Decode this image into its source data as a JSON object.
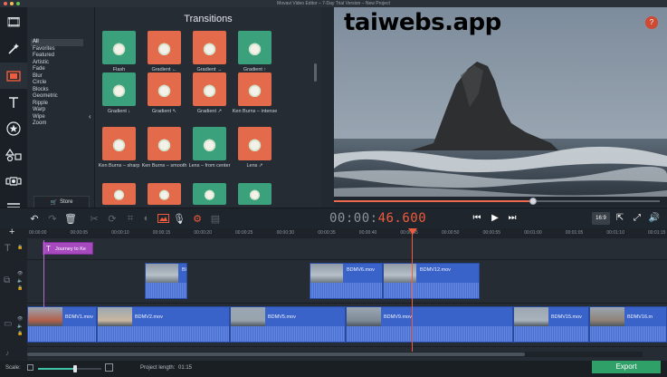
{
  "window": {
    "title": "Movavi Video Editor – 7-Day Trial Version – New Project"
  },
  "watermark": "taiwebs.app",
  "tools": [
    {
      "name": "import",
      "icon": "film-icon"
    },
    {
      "name": "filters",
      "icon": "magic-wand-icon"
    },
    {
      "name": "transitions",
      "icon": "transitions-icon"
    },
    {
      "name": "titles",
      "icon": "text-icon"
    },
    {
      "name": "stickers",
      "icon": "star-icon"
    },
    {
      "name": "shapes",
      "icon": "shapes-icon"
    },
    {
      "name": "zoom-pan",
      "icon": "camera-icon"
    },
    {
      "name": "more",
      "icon": "menu-icon"
    }
  ],
  "categories": [
    "All",
    "Favorites",
    "Featured",
    "Artistic",
    "Fade",
    "Blur",
    "Circle",
    "Blocks",
    "Geometric",
    "Ripple",
    "Warp",
    "Wipe",
    "Zoom"
  ],
  "selected_category": "All",
  "store_label": "Store",
  "transitions_title": "Transitions",
  "transitions": [
    {
      "label": "Flash",
      "row": 0,
      "col": 0,
      "bg": "#3aa17c"
    },
    {
      "label": "Gradient ←",
      "row": 0,
      "col": 1,
      "bg": "#e36a4a"
    },
    {
      "label": "Gradient →",
      "row": 0,
      "col": 2,
      "bg": "#e36a4a"
    },
    {
      "label": "Gradient ↑",
      "row": 0,
      "col": 3,
      "bg": "#3aa17c"
    },
    {
      "label": "Gradient ↓",
      "row": 1,
      "col": 0,
      "bg": "#3aa17c"
    },
    {
      "label": "Gradient ↖",
      "row": 1,
      "col": 1,
      "bg": "#e36a4a"
    },
    {
      "label": "Gradient ↗",
      "row": 1,
      "col": 2,
      "bg": "#e36a4a"
    },
    {
      "label": "Ken Burns – intense",
      "row": 1,
      "col": 3,
      "bg": "#e36a4a"
    },
    {
      "label": "Ken Burns – sharp",
      "row": 2,
      "col": 0,
      "bg": "#e36a4a"
    },
    {
      "label": "Ken Burns – smooth",
      "row": 2,
      "col": 1,
      "bg": "#e36a4a"
    },
    {
      "label": "Lens – from center",
      "row": 2,
      "col": 2,
      "bg": "#3aa17c"
    },
    {
      "label": "Lens ↗",
      "row": 2,
      "col": 3,
      "bg": "#e36a4a"
    },
    {
      "label": "",
      "row": 3,
      "col": 0,
      "bg": "#e36a4a"
    },
    {
      "label": "",
      "row": 3,
      "col": 1,
      "bg": "#e36a4a"
    },
    {
      "label": "",
      "row": 3,
      "col": 2,
      "bg": "#3aa17c"
    },
    {
      "label": "",
      "row": 3,
      "col": 3,
      "bg": "#3aa17c"
    }
  ],
  "help_label": "?",
  "player": {
    "timecode_base": "00:00:",
    "timecode_accent": "46.600",
    "progress": 0.61,
    "aspect_label": "16:9"
  },
  "ruler_ticks": [
    "00:00:00",
    "00:00:05",
    "00:00:10",
    "00:00:15",
    "00:00:20",
    "00:00:25",
    "00:00:30",
    "00:00:35",
    "00:00:40",
    "00:00:45",
    "00:00:50",
    "00:00:55",
    "00:01:00",
    "00:01:05",
    "00:01:10",
    "00:01:15"
  ],
  "title_clip": "Journey to Ke",
  "overlay_clips": [
    {
      "name": "BDMV3.mov",
      "label": "Bl"
    },
    {
      "name": "BDMV6.mov",
      "label": "BDMV6.mov"
    },
    {
      "name": "BDMV12.mov",
      "label": "BDMV12.mov"
    }
  ],
  "main_clips": [
    {
      "label": "BDMV1.mov"
    },
    {
      "label": "BDMV2.mov"
    },
    {
      "label": "BDMV5.mov"
    },
    {
      "label": "BDMV9.mov"
    },
    {
      "label": "BDMV15.mov"
    },
    {
      "label": "BDMV16.m"
    }
  ],
  "bottom": {
    "scale_label": "Scale:",
    "project_length_label": "Project length:",
    "project_length_value": "01:15",
    "export_label": "Export",
    "zoom_level": 0.58
  }
}
